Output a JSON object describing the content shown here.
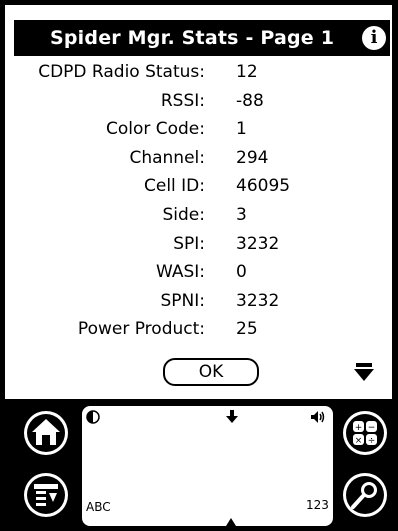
{
  "title": "Spider Mgr. Stats - Page 1",
  "info_icon": "info-icon",
  "stats": [
    {
      "label": "CDPD Radio Status:",
      "value": "12"
    },
    {
      "label": "RSSI:",
      "value": "-88"
    },
    {
      "label": "Color Code:",
      "value": "1"
    },
    {
      "label": "Channel:",
      "value": "294"
    },
    {
      "label": "Cell ID:",
      "value": "46095"
    },
    {
      "label": "Side:",
      "value": "3"
    },
    {
      "label": "SPI:",
      "value": "3232"
    },
    {
      "label": "WASI:",
      "value": "0"
    },
    {
      "label": "SPNI:",
      "value": "3232"
    },
    {
      "label": "Power Product:",
      "value": "25"
    }
  ],
  "ok_label": "OK",
  "graffiti": {
    "abc_label": "ABC",
    "num_label": "123"
  },
  "icons": [
    "home-icon",
    "menu-icon",
    "calculator-icon",
    "find-icon",
    "contrast-icon",
    "volume-icon",
    "scroll-down-icon"
  ]
}
